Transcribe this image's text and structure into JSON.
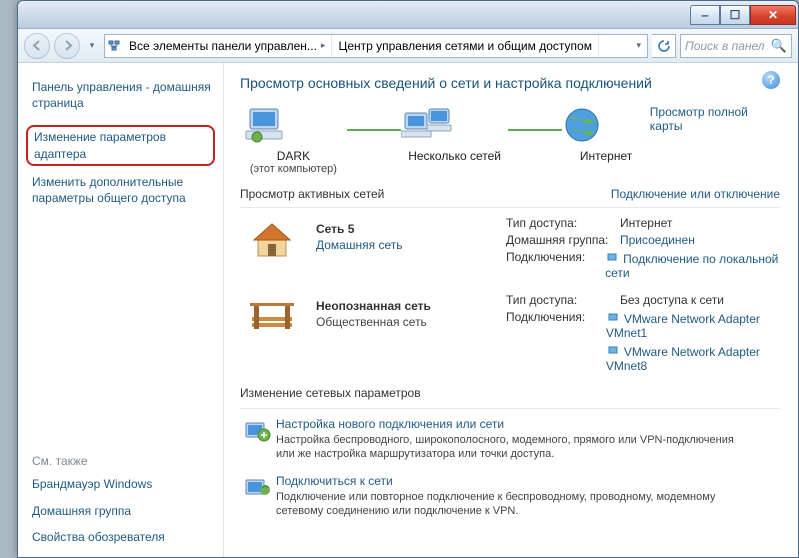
{
  "titlebar": {},
  "nav": {
    "breadcrumb_icon_label": "network-center-icon",
    "crumb1": "Все элементы панели управлен...",
    "crumb2": "Центр управления сетями и общим доступом",
    "search_placeholder": "Поиск в панел"
  },
  "sidebar": {
    "home_heading": "Панель управления - домашняя страница",
    "adapter_settings": "Изменение параметров адаптера",
    "advanced_sharing": "Изменить дополнительные параметры общего доступа",
    "see_also": "См. также",
    "firewall": "Брандмауэр Windows",
    "homegroup": "Домашняя группа",
    "internet_options": "Свойства обозревателя"
  },
  "main": {
    "heading": "Просмотр основных сведений о сети и настройка подключений",
    "map": {
      "this_pc_name": "DARK",
      "this_pc_sub": "(этот компьютер)",
      "middle": "Несколько сетей",
      "internet": "Интернет",
      "full_map_link": "Просмотр полной карты"
    },
    "active_title": "Просмотр активных сетей",
    "active_link": "Подключение или отключение",
    "net1": {
      "name": "Сеть 5",
      "type": "Домашняя сеть",
      "access_k": "Тип доступа:",
      "access_v": "Интернет",
      "hg_k": "Домашняя группа:",
      "hg_v": "Присоединен",
      "conn_k": "Подключения:",
      "conn_v": "Подключение по локальной сети"
    },
    "net2": {
      "name": "Неопознанная сеть",
      "type": "Общественная сеть",
      "access_k": "Тип доступа:",
      "access_v": "Без доступа к сети",
      "conn_k": "Подключения:",
      "conn_v1": "VMware Network Adapter VMnet1",
      "conn_v2": "VMware Network Adapter VMnet8"
    },
    "change_heading": "Изменение сетевых параметров",
    "ci1_link": "Настройка нового подключения или сети",
    "ci1_desc": "Настройка беспроводного, широкополосного, модемного, прямого или VPN-подключения или же настройка маршрутизатора или точки доступа.",
    "ci2_link": "Подключиться к сети",
    "ci2_desc": "Подключение или повторное подключение к беспроводному, проводному, модемному сетевому соединению или подключение к VPN."
  }
}
